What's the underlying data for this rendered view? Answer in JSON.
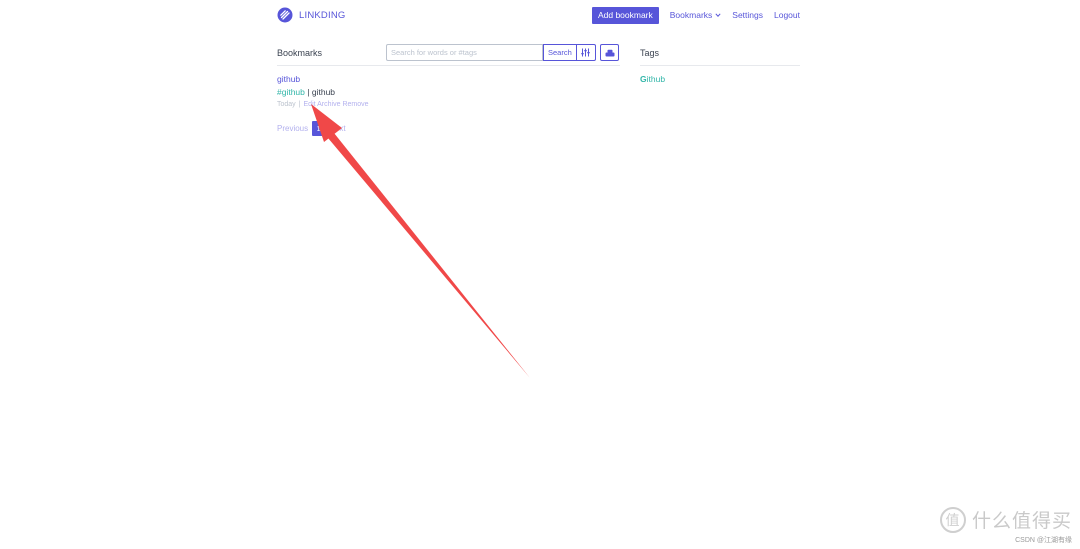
{
  "header": {
    "brand_name": "LINKDING",
    "add_bookmark": "Add bookmark",
    "bookmarks_menu": "Bookmarks",
    "settings": "Settings",
    "logout": "Logout"
  },
  "bookmarks": {
    "title": "Bookmarks",
    "search_placeholder": "Search for words or #tags",
    "search_button": "Search",
    "items": [
      {
        "title": "github",
        "tag": "#github",
        "separator": "|",
        "description": "github",
        "date": "Today",
        "actions": [
          "Edit",
          "Archive",
          "Remove"
        ]
      }
    ],
    "pagination": {
      "previous": "Previous",
      "current": "1",
      "next": "Next"
    }
  },
  "tags": {
    "title": "Tags",
    "items": [
      {
        "first_letter": "G",
        "rest": "ithub"
      }
    ]
  },
  "watermark": {
    "logo_char": "值",
    "main": "什么值得买",
    "sub": "CSDN @江湖有缘"
  },
  "colors": {
    "primary": "#5755d9",
    "tag": "#32b6a9",
    "muted": "#bcc3ce",
    "annotation_arrow": "#f04848"
  },
  "icons": {
    "brand": "linkding-logo-icon",
    "bookmarks_menu": "chevron-down-icon",
    "filter": "sliders-icon",
    "bulk_edit": "bulk-edit-icon"
  }
}
